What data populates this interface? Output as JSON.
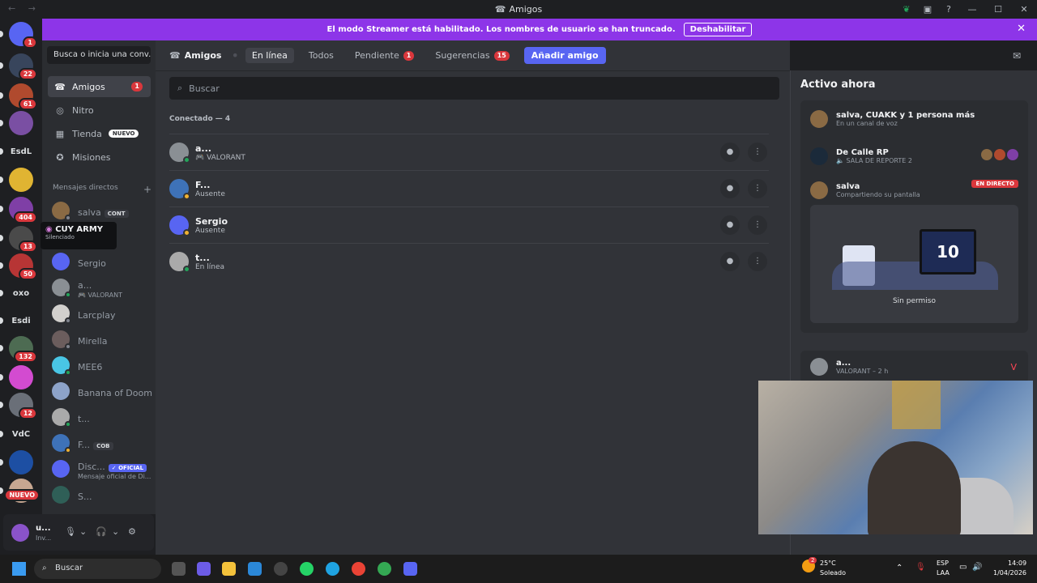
{
  "window": {
    "title": "Amigos",
    "nav": "← →",
    "title_icon": "friends-icon"
  },
  "banner": {
    "text": "El modo Streamer está habilitado. Los nombres de usuario se han truncado.",
    "button": "Deshabilitar"
  },
  "servers": [
    {
      "badge": "1",
      "color": "#5865f2",
      "label": ""
    },
    {
      "badge": "22",
      "color": "#38455c",
      "label": ""
    },
    {
      "badge": "61",
      "color": "#b04a2e",
      "label": ""
    },
    {
      "badge": "",
      "color": "#7a4fa3",
      "label": ""
    },
    {
      "badge": "",
      "color": "transparent",
      "label": "EsdL"
    },
    {
      "badge": "",
      "color": "#e0b432",
      "label": ""
    },
    {
      "badge": "404",
      "color": "#7f3fa6",
      "label": ""
    },
    {
      "badge": "13",
      "color": "#4a4a4a",
      "label": ""
    },
    {
      "badge": "50",
      "color": "#b73535",
      "label": ""
    },
    {
      "badge": "2",
      "color": "transparent",
      "label": "oxo"
    },
    {
      "badge": "4",
      "color": "transparent",
      "label": "Esdi"
    },
    {
      "badge": "132",
      "color": "#4d6b52",
      "label": ""
    },
    {
      "badge": "",
      "color": "#d34bd0",
      "label": ""
    },
    {
      "badge": "12",
      "color": "#6a6f78",
      "label": ""
    },
    {
      "badge": "",
      "color": "transparent",
      "label": "VdC"
    },
    {
      "badge": "",
      "color": "#1d4fa3",
      "label": ""
    },
    {
      "badge": "NUEVO",
      "color": "#c7a791",
      "label": ""
    }
  ],
  "sidebar": {
    "search": "Busca o inicia una conv...",
    "nav": [
      {
        "label": "Amigos",
        "badge": "1",
        "icon": "friends-icon"
      },
      {
        "label": "Nitro",
        "icon": "nitro-icon"
      },
      {
        "label": "Tienda",
        "tag": "NUEVO",
        "icon": "shop-icon"
      },
      {
        "label": "Misiones",
        "icon": "quests-icon"
      }
    ],
    "dm_header": "Mensajes directos",
    "dm_add": "+",
    "dms": [
      {
        "name": "salva",
        "tag": "CONT",
        "color": "#8a6a44"
      },
      {
        "name": "",
        "sub": "",
        "color": "#555"
      },
      {
        "name": "Sergio",
        "color": "#5865f2"
      },
      {
        "name": "a...",
        "sub": "🎮 VALORANT",
        "color": "#8a8f94"
      },
      {
        "name": "Larcplay",
        "color": "#d2d0cd"
      },
      {
        "name": "Mirella",
        "color": "#6b5d5d"
      },
      {
        "name": "MEE6",
        "color": "#49c6e5"
      },
      {
        "name": "Banana of Doom",
        "color": "#8da3c9"
      },
      {
        "name": "t...",
        "color": "#aaa"
      },
      {
        "name": "F...",
        "tag": "COB",
        "color": "#3e72b8"
      },
      {
        "name": "Disc...",
        "tag": "✓ OFICIAL",
        "sub": "Mensaje oficial de Di...",
        "color": "#5865f2"
      },
      {
        "name": "S...",
        "color": "#2f5f57"
      }
    ],
    "tooltip": {
      "title": "CUY ARMY",
      "subtitle": "Silenciado"
    }
  },
  "user": {
    "name": "u...",
    "status": "Inv...",
    "mic": "🎙",
    "headset": "🎧",
    "settings": "⚙"
  },
  "toolbar": {
    "friends": "Amigos",
    "tabs": [
      {
        "label": "En línea",
        "active": true
      },
      {
        "label": "Todos"
      },
      {
        "label": "Pendiente",
        "count": "1"
      },
      {
        "label": "Sugerencias",
        "count": "15"
      }
    ],
    "add": "Añadir amigo"
  },
  "main": {
    "search_placeholder": "Buscar",
    "online_header": "Conectado — 4",
    "friends": [
      {
        "name": "a...",
        "status": "🎮 VALORANT",
        "color": "#8a8f94",
        "dot": "#23a55a"
      },
      {
        "name": "F...",
        "status": "Ausente",
        "color": "#3e72b8",
        "dot": "#f0b232"
      },
      {
        "name": "Sergio",
        "status": "Ausente",
        "color": "#5865f2",
        "dot": "#f0b232"
      },
      {
        "name": "t...",
        "status": "En línea",
        "color": "#aaa",
        "dot": "#23a55a"
      }
    ]
  },
  "active_now": {
    "title": "Activo ahora",
    "voice": {
      "title": "salva, CUAKK y 1 persona más",
      "subtitle": "En un canal de voz"
    },
    "server": {
      "title": "De Calle RP",
      "subtitle": "SALA DE REPORTE 2"
    },
    "stream": {
      "user": "salva",
      "subtitle": "Compartiendo su pantalla",
      "live": "EN DIRECTO",
      "caption": "Sin permiso",
      "tv": "10"
    },
    "game": {
      "title": "a...",
      "subtitle": "VALORANT – 2 h"
    }
  },
  "taskbar": {
    "search": "Buscar",
    "weather": {
      "temp": "25°C",
      "cond": "Soleado",
      "badge": "2"
    },
    "lang": "ESP",
    "lang2": "LAA",
    "time": "14:09",
    "date": "1/04/2026"
  }
}
